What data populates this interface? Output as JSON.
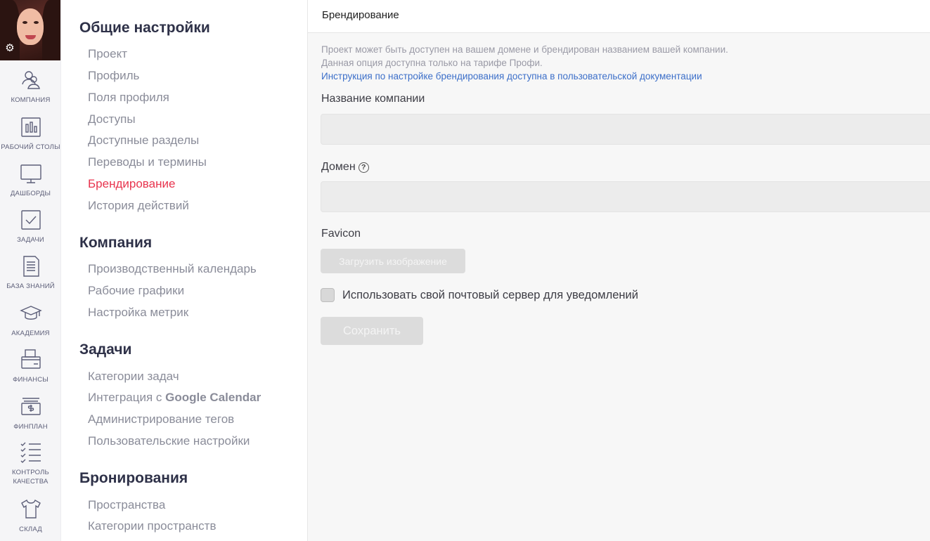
{
  "rail": {
    "items": [
      {
        "label": "КОМПАНИЯ",
        "icon": "company-icon"
      },
      {
        "label": "РАБОЧИЙ СТОЛЫ",
        "icon": "desktops-icon"
      },
      {
        "label": "ДАШБОРДЫ",
        "icon": "dashboards-icon"
      },
      {
        "label": "ЗАДАЧИ",
        "icon": "tasks-icon"
      },
      {
        "label": "БАЗА ЗНАНИЙ",
        "icon": "knowledge-base-icon"
      },
      {
        "label": "АКАДЕМИЯ",
        "icon": "academy-icon"
      },
      {
        "label": "ФИНАНСЫ",
        "icon": "finance-icon"
      },
      {
        "label": "ФИНПЛАН",
        "icon": "finplan-icon"
      },
      {
        "label": "КОНТРОЛЬ",
        "label2": "КАЧЕСТВА",
        "icon": "quality-control-icon"
      },
      {
        "label": "СКЛАД",
        "icon": "warehouse-icon"
      }
    ],
    "color": "#5c5e78"
  },
  "nav": {
    "sections": [
      {
        "heading": "Общие настройки",
        "items": [
          "Проект",
          "Профиль",
          "Поля профиля",
          "Доступы",
          "Доступные разделы",
          "Переводы и термины",
          "Брендирование",
          "История действий"
        ]
      },
      {
        "heading": "Компания",
        "items": [
          "Производственный календарь",
          "Рабочие графики",
          "Настройка метрик"
        ]
      },
      {
        "heading": "Задачи",
        "items": [
          "Категории задач",
          "Интеграция с ",
          "Администрирование тегов",
          "Пользовательские настройки"
        ],
        "google_calendar": "Google Calendar"
      },
      {
        "heading": "Бронирования",
        "items": [
          "Пространства",
          "Категории пространств"
        ]
      }
    ],
    "active_color": "#e8344e"
  },
  "main": {
    "title": "Брендирование",
    "info_line1": "Проект может быть доступен на вашем домене и брендирован названием вашей компании.",
    "info_line2": "Данная опция доступна только на тарифе Профи.",
    "info_link": "Инструкция по настройке брендирования доступна в пользовательской документации",
    "company_name_label": "Название компании",
    "company_name_value": "",
    "domain_label": "Домен",
    "domain_value": "",
    "help_glyph": "?",
    "favicon_label": "Favicon",
    "upload_label": "Загрузить изображение",
    "mail_server_label": "Использовать свой почтовый сервер для уведомлений",
    "save_label": "Сохранить",
    "link_color": "#3c6fc9"
  }
}
